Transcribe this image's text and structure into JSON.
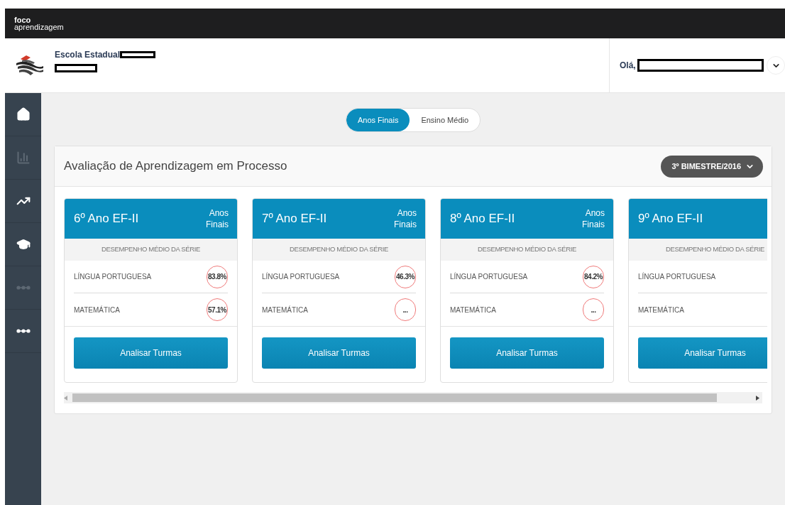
{
  "topbar": {
    "brand_line1": "foco",
    "brand_line2": "aprendizagem"
  },
  "header": {
    "school": "Escola Estadual",
    "greeting": "Olá,"
  },
  "sidebar": {
    "items": [
      {
        "disabled": false
      },
      {
        "disabled": true
      },
      {
        "disabled": false
      },
      {
        "disabled": false
      },
      {
        "disabled": true
      },
      {
        "disabled": false
      }
    ]
  },
  "segments": [
    {
      "label": "Anos Finais",
      "selected": true
    },
    {
      "label": "Ensino Médio",
      "selected": false
    }
  ],
  "panel": {
    "title": "Avaliação de Aprendizagem em Processo",
    "period": "3º BIMESTRE/2016",
    "cards": [
      {
        "title": "6º Ano EF-II",
        "tag_line1": "Anos",
        "tag_line2": "Finais",
        "section": "DESEMPENHO MÉDIO DA SÉRIE",
        "rows": [
          {
            "subject": "LÍNGUA PORTUGUESA",
            "score": "83.8%"
          },
          {
            "subject": "MATEMÁTICA",
            "score": "57.1%"
          }
        ],
        "button": "Analisar Turmas"
      },
      {
        "title": "7º Ano EF-II",
        "tag_line1": "Anos",
        "tag_line2": "Finais",
        "section": "DESEMPENHO MÉDIO DA SÉRIE",
        "rows": [
          {
            "subject": "LÍNGUA PORTUGUESA",
            "score": "46.3%"
          },
          {
            "subject": "MATEMÁTICA",
            "score": "..."
          }
        ],
        "button": "Analisar Turmas"
      },
      {
        "title": "8º Ano EF-II",
        "tag_line1": "Anos",
        "tag_line2": "Finais",
        "section": "DESEMPENHO MÉDIO DA SÉRIE",
        "rows": [
          {
            "subject": "LÍNGUA PORTUGUESA",
            "score": "84.2%"
          },
          {
            "subject": "MATEMÁTICA",
            "score": "..."
          }
        ],
        "button": "Analisar Turmas"
      },
      {
        "title": "9º Ano EF-II",
        "section": "DESEMPENHO MÉDIO DA SÉRIE",
        "rows": [
          {
            "subject": "LÍNGUA PORTUGUESA"
          },
          {
            "subject": "MATEMÁTICA"
          }
        ],
        "button": "Analisar Turmas"
      }
    ]
  }
}
